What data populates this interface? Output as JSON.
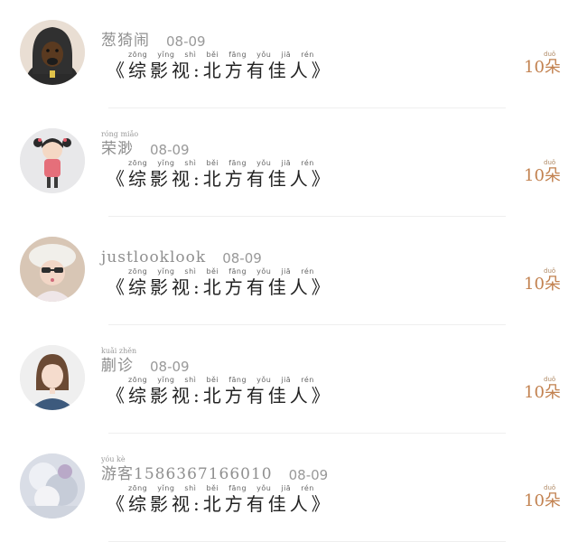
{
  "rows": [
    {
      "username": "葱猗闹",
      "username_pinyin": "",
      "date": "08-09",
      "title_pinyin": "zōng yǐng shì běi fāng yǒu jiā rén",
      "title": "《综影视:北方有佳人》",
      "count": "10朵",
      "count_pinyin": "duǒ",
      "avatar_icon": "dog-avatar"
    },
    {
      "username": "荣渺",
      "username_pinyin": "róng miǎo",
      "date": "08-09",
      "title_pinyin": "zōng yǐng shì běi fāng yǒu jiā rén",
      "title": "《综影视:北方有佳人》",
      "count": "10朵",
      "count_pinyin": "duǒ",
      "avatar_icon": "girl-cartoon-avatar"
    },
    {
      "username": "justlooklook",
      "username_pinyin": "",
      "date": "08-09",
      "title_pinyin": "zōng yǐng shì běi fāng yǒu jiā rén",
      "title": "《综影视:北方有佳人》",
      "count": "10朵",
      "count_pinyin": "duǒ",
      "avatar_icon": "child-hat-avatar"
    },
    {
      "username": "蒯诊",
      "username_pinyin": "kuǎi zhěn",
      "date": "08-09",
      "title_pinyin": "zōng yǐng shì běi fāng yǒu jiā rén",
      "title": "《综影视:北方有佳人》",
      "count": "10朵",
      "count_pinyin": "duǒ",
      "avatar_icon": "woman-photo-avatar"
    },
    {
      "username": "游客1586367166010",
      "username_pinyin": "yóu kè",
      "date": "08-09",
      "title_pinyin": "zōng yǐng shì běi fāng yǒu jiā rén",
      "title": "《综影视:北方有佳人》",
      "count": "10朵",
      "count_pinyin": "duǒ",
      "avatar_icon": "blurred-avatar"
    }
  ],
  "colors": {
    "accent": "#c2814f",
    "muted": "#8f8f8f",
    "divider": "#efefef"
  }
}
